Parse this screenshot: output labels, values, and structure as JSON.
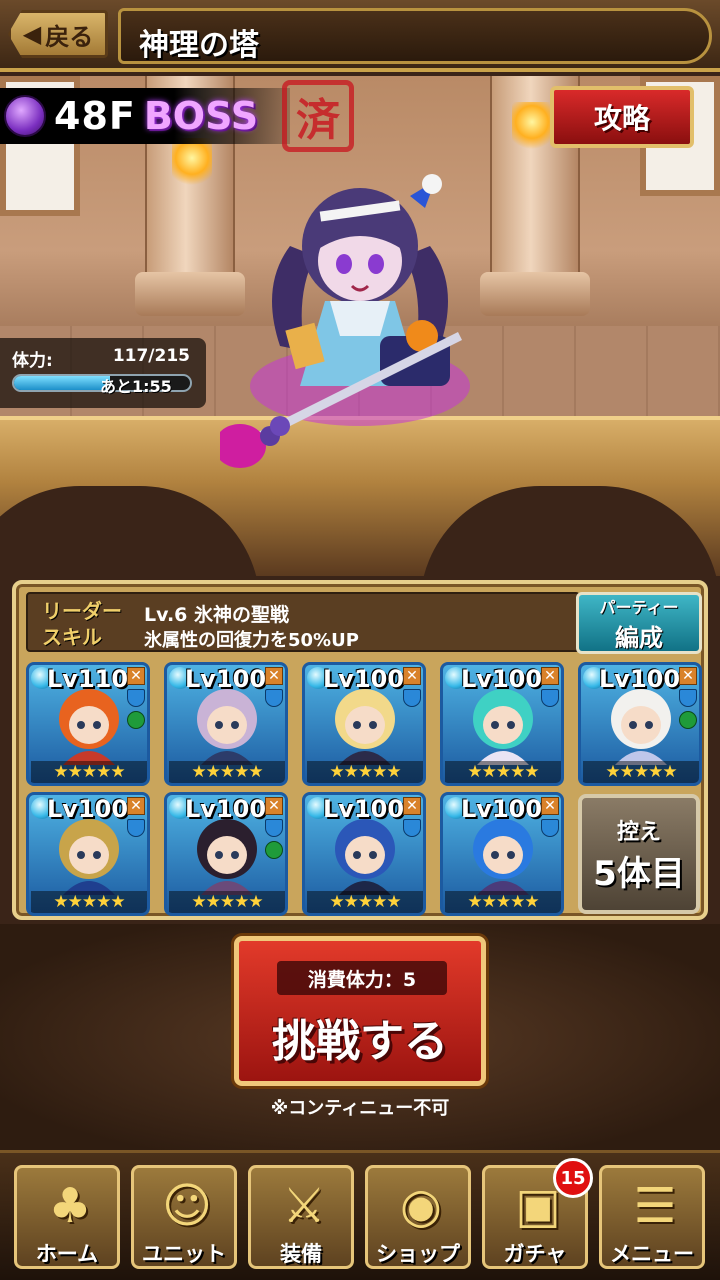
{
  "header": {
    "back_label": "戻る",
    "title": "神理の塔"
  },
  "stage": {
    "floor": "48F",
    "boss": "BOSS",
    "cleared_stamp": "済",
    "strategy_label": "攻略"
  },
  "stamina": {
    "label": "体力:",
    "value": "117/215",
    "current": 117,
    "max": 215,
    "remaining": "あと1:55"
  },
  "party": {
    "leader_label_line1": "リーダー",
    "leader_label_line2": "スキル",
    "leader_skill_name": "Lv.6 氷神の聖戦",
    "leader_skill_desc": "氷属性の回復力を50%UP",
    "edit_label_line1": "パーティー",
    "edit_label_line2": "編成",
    "units": [
      {
        "level": "Lv110",
        "stars": "★★★★★",
        "hair": "#e8631f",
        "outfit": "#c73a2a",
        "green_mark": true
      },
      {
        "level": "Lv100",
        "stars": "★★★★★",
        "hair": "#c9b3d6",
        "outfit": "#2c3c6a",
        "green_mark": false
      },
      {
        "level": "Lv100",
        "stars": "★★★★★",
        "hair": "#f2d98a",
        "outfit": "#2b2b4a",
        "green_mark": false
      },
      {
        "level": "Lv100",
        "stars": "★★★★★",
        "hair": "#3fd1c4",
        "outfit": "#e9e4f4",
        "green_mark": false
      },
      {
        "level": "Lv100",
        "stars": "★★★★★",
        "hair": "#f2f1ee",
        "outfit": "#bfc7ea",
        "green_mark": true
      },
      {
        "level": "Lv100",
        "stars": "★★★★★",
        "hair": "#c8a44a",
        "outfit": "#1f3f8f",
        "green_mark": false
      },
      {
        "level": "Lv100",
        "stars": "★★★★★",
        "hair": "#2b1f2e",
        "outfit": "#6a4a7a",
        "green_mark": true
      },
      {
        "level": "Lv100",
        "stars": "★★★★★",
        "hair": "#2b57b8",
        "outfit": "#1d2748",
        "green_mark": false
      },
      {
        "level": "Lv100",
        "stars": "★★★★★",
        "hair": "#2a7ae0",
        "outfit": "#4b3b7a",
        "green_mark": false
      }
    ],
    "reserve_line1": "控え",
    "reserve_line2": "5体目"
  },
  "challenge": {
    "cost_label": "消費体力：5",
    "button_label": "挑戦する",
    "note": "※コンティニュー不可"
  },
  "nav": {
    "items": [
      {
        "label": "ホーム",
        "icon": "home-icon",
        "glyph": "♣"
      },
      {
        "label": "ユニット",
        "icon": "unit-icon",
        "glyph": "☺"
      },
      {
        "label": "装備",
        "icon": "equipment-icon",
        "glyph": "⚔"
      },
      {
        "label": "ショップ",
        "icon": "shop-icon",
        "glyph": "◉"
      },
      {
        "label": "ガチャ",
        "icon": "gacha-icon",
        "glyph": "▣"
      },
      {
        "label": "メニュー",
        "icon": "menu-icon",
        "glyph": "☰"
      }
    ],
    "gacha_badge": "15"
  },
  "colors": {
    "accent_gold": "#e6c57a",
    "challenge_red": "#d0281c",
    "party_edit_teal": "#1e8fa3"
  }
}
